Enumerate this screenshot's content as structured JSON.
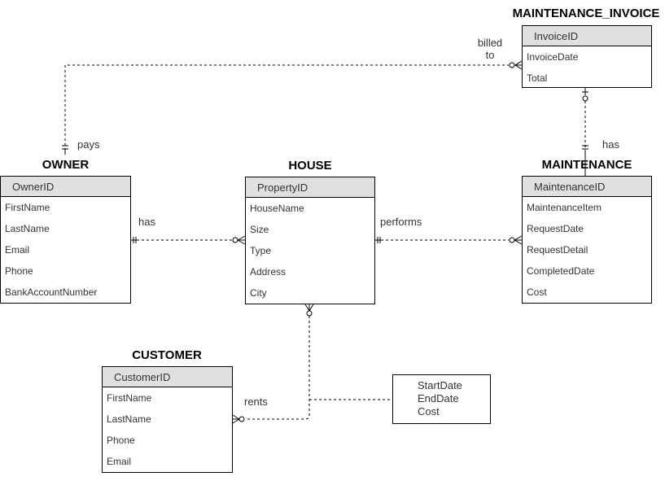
{
  "entities": {
    "invoice": {
      "title": "MAINTENANCE_INVOICE",
      "pk": "InvoiceID",
      "attributes": [
        "InvoiceDate",
        "Total"
      ]
    },
    "owner": {
      "title": "OWNER",
      "pk": "OwnerID",
      "attributes": [
        "FirstName",
        "LastName",
        "Email",
        "Phone",
        "BankAccountNumber"
      ]
    },
    "house": {
      "title": "HOUSE",
      "pk": "PropertyID",
      "attributes": [
        "HouseName",
        "Size",
        "Type",
        "Address",
        "City"
      ]
    },
    "maintenance": {
      "title": "MAINTENANCE",
      "pk": "MaintenanceID",
      "attributes": [
        "MaintenanceItem",
        "RequestDate",
        "RequestDetail",
        "CompletedDate",
        "Cost"
      ]
    },
    "customer": {
      "title": "CUSTOMER",
      "pk": "CustomerID",
      "attributes": [
        "FirstName",
        "LastName",
        "Phone",
        "Email"
      ]
    }
  },
  "relationships": {
    "billed_to": {
      "label_line1": "billed",
      "label_line2": "to",
      "from": "OWNER",
      "to": "MAINTENANCE_INVOICE",
      "from_cardinality": "one-and-only-one",
      "to_cardinality": "zero-or-many"
    },
    "pays": {
      "label": "pays"
    },
    "invoice_has": {
      "label": "has",
      "from": "MAINTENANCE",
      "to": "MAINTENANCE_INVOICE",
      "from_cardinality": "one-and-only-one",
      "to_cardinality": "zero-or-one"
    },
    "owner_has": {
      "label": "has",
      "from": "OWNER",
      "to": "HOUSE",
      "from_cardinality": "one-and-only-one",
      "to_cardinality": "zero-or-many"
    },
    "performs": {
      "label": "performs",
      "from": "HOUSE",
      "to": "MAINTENANCE",
      "from_cardinality": "one-and-only-one",
      "to_cardinality": "zero-or-many"
    },
    "rents": {
      "label": "rents",
      "from": "CUSTOMER",
      "to": "HOUSE",
      "from_cardinality": "zero-or-many",
      "to_cardinality": "zero-or-many",
      "attributes": [
        "StartDate",
        "EndDate",
        "Cost"
      ]
    }
  }
}
